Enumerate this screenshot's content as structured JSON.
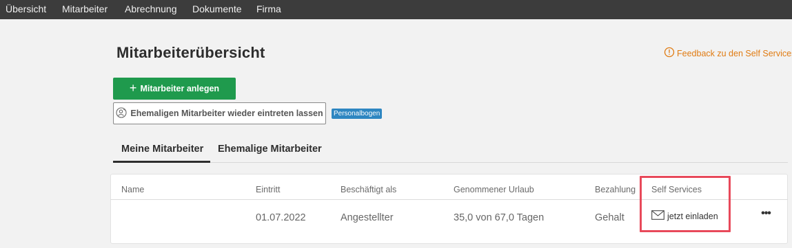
{
  "nav": {
    "items": [
      {
        "label": "Übersicht"
      },
      {
        "label": "Mitarbeiter"
      },
      {
        "label": "Abrechnung"
      },
      {
        "label": "Dokumente"
      },
      {
        "label": "Firma"
      }
    ]
  },
  "header": {
    "title": "Mitarbeiterübersicht",
    "feedback_label": "Feedback zu den Self Services"
  },
  "actions": {
    "add_employee_label": "Mitarbeiter anlegen",
    "rehire_label": "Ehemaligen Mitarbeiter wieder eintreten lassen",
    "personalbogen_label": "Personalbogen"
  },
  "tabs": [
    {
      "label": "Meine Mitarbeiter",
      "active": true
    },
    {
      "label": "Ehemalige Mitarbeiter",
      "active": false
    }
  ],
  "table": {
    "columns": [
      "Name",
      "Eintritt",
      "Beschäftigt als",
      "Genommener Urlaub",
      "Bezahlung",
      "Self Services"
    ],
    "rows": [
      {
        "name": "",
        "eintritt": "01.07.2022",
        "beschaeftigt_als": "Angestellter",
        "urlaub": "35,0 von 67,0 Tagen",
        "bezahlung": "Gehalt",
        "self_services": "jetzt einladen"
      }
    ]
  },
  "colors": {
    "primary_green": "#1f9a4d",
    "feedback_orange": "#e07b12",
    "badge_blue": "#2e86c1",
    "highlight_red": "#e8495a",
    "nav_bg": "#3c3c3c"
  },
  "icons": {
    "feedback": "alert-circle-icon",
    "add": "plus-icon",
    "rehire": "user-refresh-icon",
    "invite": "envelope-icon",
    "more": "more-horizontal-icon"
  }
}
